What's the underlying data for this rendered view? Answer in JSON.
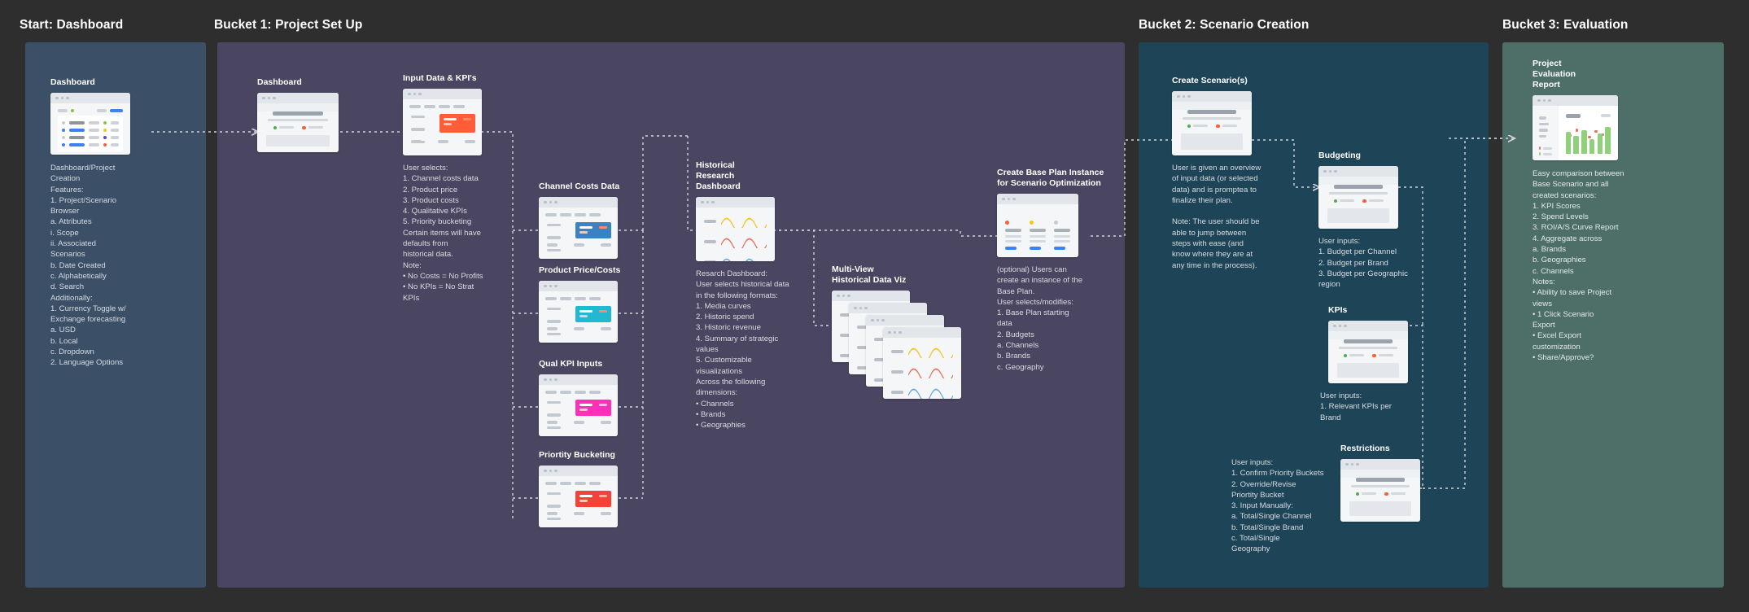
{
  "headers": [
    {
      "label": "Start: Dashboard"
    },
    {
      "label": "Bucket 1: Project Set Up"
    },
    {
      "label": "Bucket 2: Scenario Creation"
    },
    {
      "label": "Bucket 3: Evaluation"
    }
  ],
  "colors": {
    "canvas": "#2e2e2e",
    "panel_start": "#3b4f66",
    "panel_bucket1": "#4a4560",
    "panel_bucket2": "#1d4457",
    "panel_bucket3": "#4e6e68",
    "accent_orange": "#ff5c39",
    "accent_blue": "#3b82c4",
    "accent_cyan": "#22b8cf",
    "accent_magenta": "#ff2fb9",
    "accent_red": "#f44336",
    "accent_green": "#8ed17a"
  },
  "nodes": {
    "start_dashboard": {
      "title": "Dashboard",
      "body": "Dashboard/Project\nCreation\nFeatures:\n  1. Project/Scenario\n      Browser\n      a. Attributes\n           i. Scope\n          ii. Associated\n              Scenarios\n      b. Date Created\n      c. Alphabetically\n      d. Search\nAdditionally:\n  1. Currency Toggle w/\n      Exchange forecasting\n      a. USD\n      b. Local\n      c. Dropdown\n  2. Language Options"
    },
    "b1_dashboard": {
      "title": "Dashboard"
    },
    "input_data": {
      "title": "Input Data & KPI's",
      "body": "User selects:\n  1. Channel costs data\n  2. Product price\n  3. Product costs\n  4. Qualitative KPIs\n  5. Priority bucketing\n      Certain items will have\n      defaults from\n      historical data.\nNote:\n  •  No Costs = No Profits\n  •  No KPIs = No Strat\n      KPIs"
    },
    "channel_costs": {
      "title": "Channel Costs Data",
      "color": "#3b82c4"
    },
    "product_price": {
      "title": "Product Price/Costs",
      "color": "#22b8cf"
    },
    "qual_kpi": {
      "title": "Qual KPI Inputs",
      "color": "#ff2fb9"
    },
    "priority_bucket": {
      "title": "Priortity Bucketing",
      "color": "#f44336"
    },
    "historical_research": {
      "title": "Historical\nResearch\nDashboard",
      "body": "Resarch Dashboard:\nUser selects historical data\nin the following formats:\n  1. Media curves\n  2. Historic spend\n  3. Historic revenue\n  4. Summary of strategic\n      values\n  5. Customizable\n      visualizations\nAcross the following\ndimensions:\n  •  Channels\n  •  Brands\n  •  Geographies"
    },
    "multi_view": {
      "title": "Multi-View\nHistorical Data Viz"
    },
    "base_plan": {
      "title": "Create Base Plan Instance\nfor Scenario Optimization",
      "body": "(optional) Users can\ncreate an instance of the\nBase Plan.\nUser selects/modifies:\n  1. Base Plan starting\n      data\n  2. Budgets\n      a. Channels\n      b. Brands\n      c. Geography"
    },
    "create_scenarios": {
      "title": "Create Scenario(s)",
      "body": "User is given an overview\nof input data (or selected\ndata) and is promptea to\nfinalize their plan.\n\nNote: The user should be\nable to jump between\nsteps with ease (and\nknow where they are at\nany time in the process)."
    },
    "budgeting": {
      "title": "Budgeting",
      "body": "User inputs:\n  1. Budget per Channel\n  2. Budget per Brand\n  3. Budget per Geographic\n      region"
    },
    "kpis": {
      "title": "KPIs",
      "body": "User inputs:\n  1. Relevant KPIs per\n      Brand"
    },
    "restrictions": {
      "title": "Restrictions",
      "body": "User inputs:\n  1. Confirm Priority Buckets\n  2. Override/Revise\n      Priortity Bucket\n  3. Input Manually:\n      a. Total/Single Channel\n      b. Total/Single Brand\n      c. Total/Single\n          Geography"
    },
    "evaluation_report": {
      "title": "Project\nEvaluation\nReport",
      "body": "Easy comparison between\nBase Scenario and all\ncreated scenarios:\n  1. KPI Scores\n  2. Spend Levels\n  3. ROI/A/S Curve Report\n  4. Aggregate across\n      a. Brands\n      b. Geographies\n      c. Channels\nNotes:\n  •  Ability to save Project\n      views\n  •  1 Click Scenario\n      Export\n  •  Excel Export\n      customization\n  •  Share/Approve?"
    }
  }
}
